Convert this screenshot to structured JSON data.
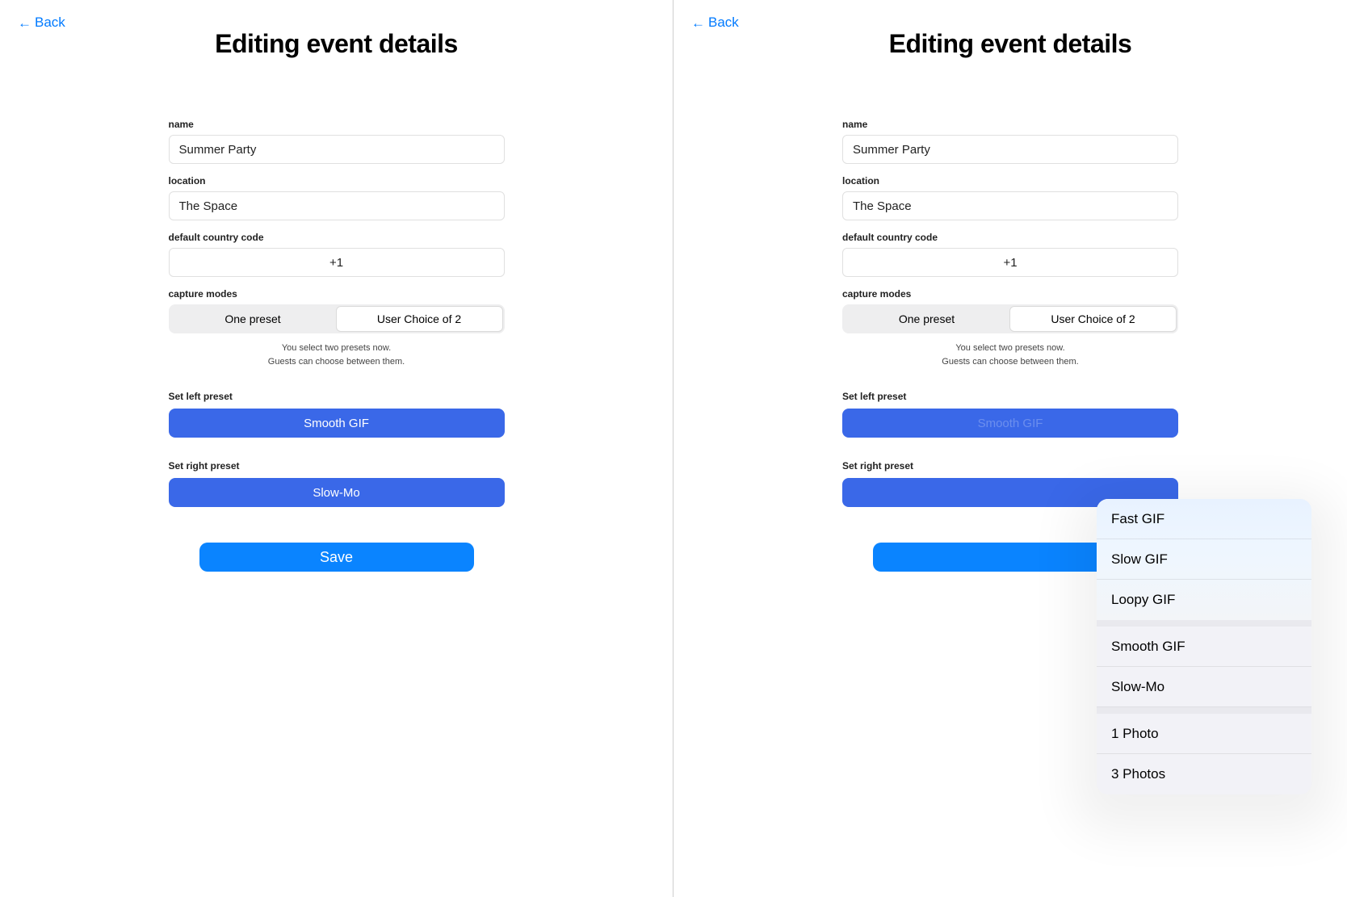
{
  "back_label": "Back",
  "page_title": "Editing event details",
  "labels": {
    "name": "name",
    "location": "location",
    "default_cc": "default country code",
    "capture_modes": "capture modes",
    "set_left": "Set left preset",
    "set_right": "Set right preset"
  },
  "values": {
    "name": "Summer Party",
    "location": "The Space",
    "default_cc": "+1"
  },
  "segments": {
    "one_preset": "One preset",
    "user_choice": "User Choice of 2"
  },
  "helper": {
    "line1": "You select two presets now.",
    "line2": "Guests can choose between them."
  },
  "presets": {
    "left": "Smooth GIF",
    "right": "Slow-Mo"
  },
  "save_label": "Save",
  "popover_options": [
    "Fast GIF",
    "Slow GIF",
    "Loopy GIF",
    "Smooth GIF",
    "Slow-Mo",
    "1 Photo",
    "3 Photos"
  ]
}
